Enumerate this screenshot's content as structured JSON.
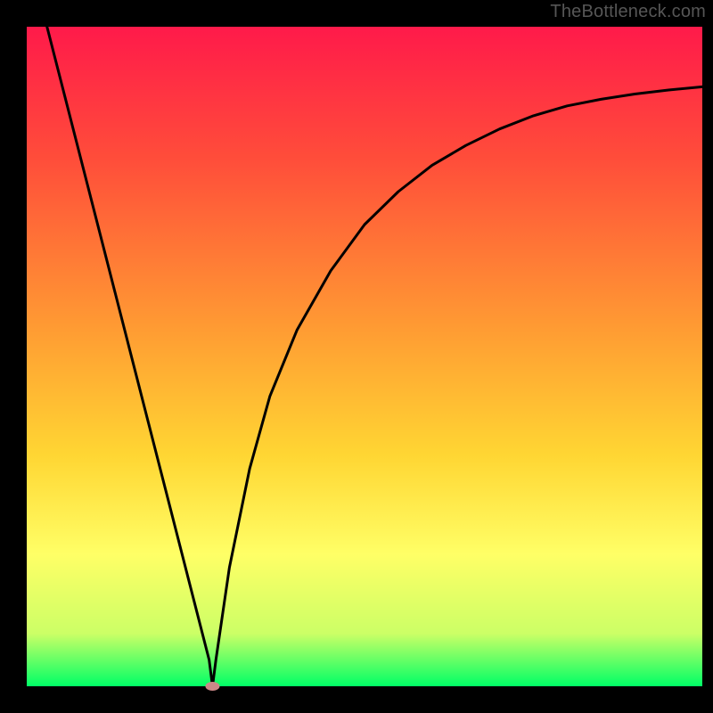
{
  "watermark": "TheBottleneck.com",
  "chart_data": {
    "type": "line",
    "title": "",
    "xlabel": "",
    "ylabel": "",
    "xlim": [
      0,
      100
    ],
    "ylim": [
      0,
      100
    ],
    "grid": false,
    "legend": false,
    "background_gradient": {
      "stops": [
        {
          "offset": 0.0,
          "color": "#ff1a4a"
        },
        {
          "offset": 0.2,
          "color": "#ff4d3a"
        },
        {
          "offset": 0.45,
          "color": "#ff9933"
        },
        {
          "offset": 0.65,
          "color": "#ffd633"
        },
        {
          "offset": 0.8,
          "color": "#ffff66"
        },
        {
          "offset": 0.92,
          "color": "#ccff66"
        },
        {
          "offset": 1.0,
          "color": "#00ff66"
        }
      ]
    },
    "series": [
      {
        "name": "bottleneck-curve",
        "type": "line",
        "x": [
          3,
          6,
          9,
          12,
          15,
          18,
          21,
          24,
          27,
          27.5,
          28,
          30,
          33,
          36,
          40,
          45,
          50,
          55,
          60,
          65,
          70,
          75,
          80,
          85,
          90,
          95,
          100
        ],
        "y": [
          100,
          88,
          76,
          64,
          52,
          40,
          28,
          16,
          4,
          0,
          4,
          18,
          33,
          44,
          54,
          63,
          70,
          75,
          79,
          82,
          84.5,
          86.5,
          88,
          89,
          89.8,
          90.4,
          90.9
        ],
        "color": "#000000"
      }
    ],
    "marker": {
      "name": "optimal-point",
      "x": 27.5,
      "y": 0,
      "color": "#cc8888",
      "rx": 8,
      "ry": 5
    }
  }
}
